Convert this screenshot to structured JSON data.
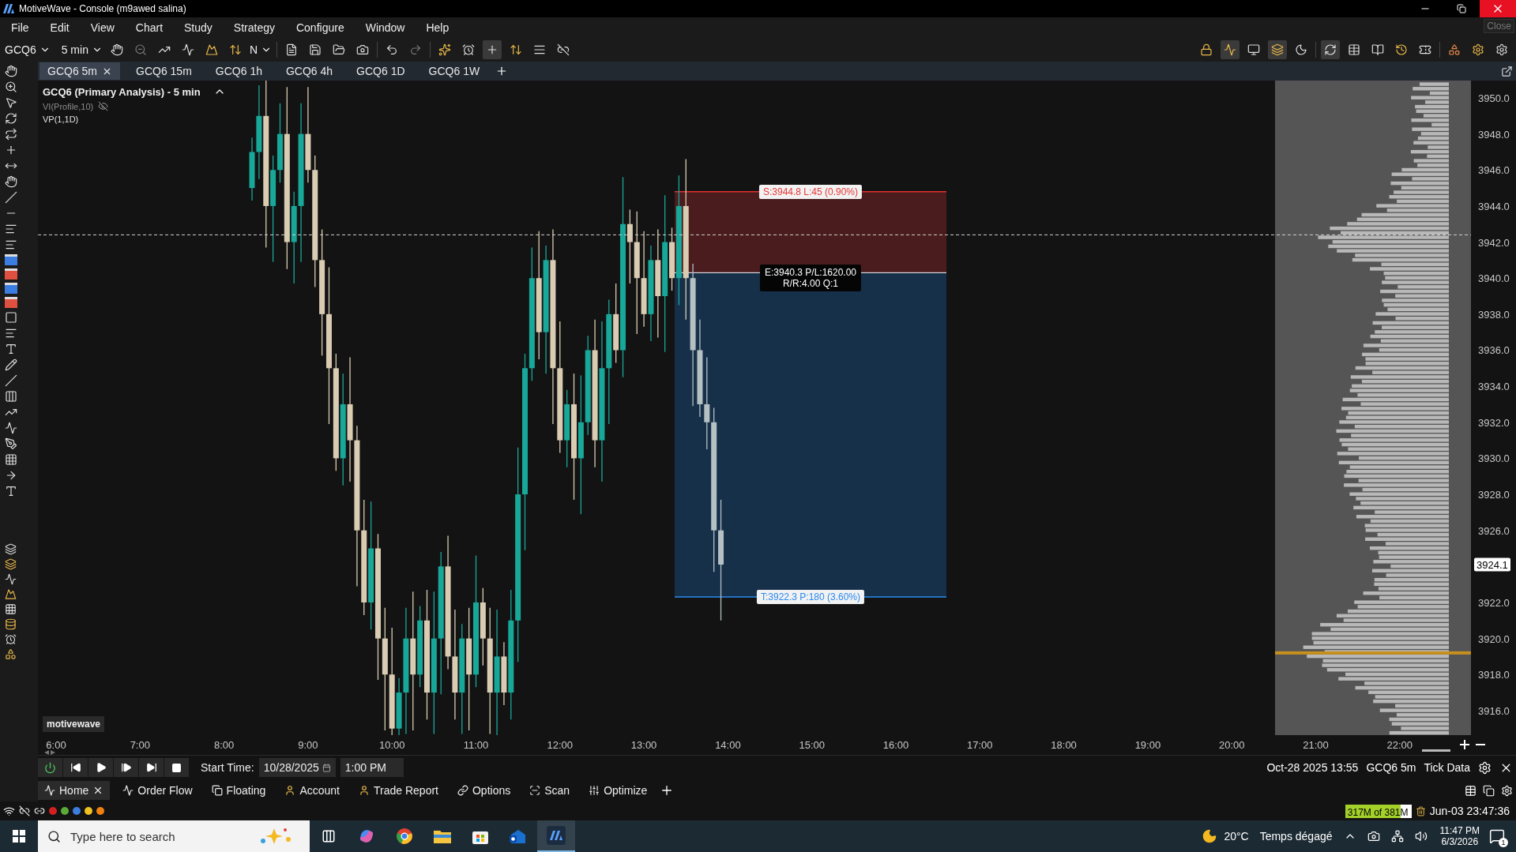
{
  "window": {
    "title": "MotiveWave - Console (m9awed salina)",
    "tooltip": "Close"
  },
  "menu": [
    "File",
    "Edit",
    "View",
    "Chart",
    "Study",
    "Strategy",
    "Configure",
    "Window",
    "Help"
  ],
  "toolbar": {
    "symbol": "GCQ6",
    "interval": "5 min",
    "bar_type": "N"
  },
  "tabs": [
    {
      "label": "GCQ6 5m",
      "selected": true
    },
    {
      "label": "GCQ6 15m",
      "selected": false
    },
    {
      "label": "GCQ6 1h",
      "selected": false
    },
    {
      "label": "GCQ6 4h",
      "selected": false
    },
    {
      "label": "GCQ6 1D",
      "selected": false
    },
    {
      "label": "GCQ6 1W",
      "selected": false
    }
  ],
  "chart": {
    "title": "GCQ6 (Primary Analysis) - 5 min",
    "studies": [
      {
        "label": "VI(Profile,10)",
        "hidden": true
      },
      {
        "label": "VP(1,1D)",
        "hidden": false
      }
    ],
    "brand_label": "motivewave",
    "price_axis": [
      "3950.0",
      "3948.0",
      "3946.0",
      "3944.0",
      "3942.0",
      "3940.0",
      "3938.0",
      "3936.0",
      "3934.0",
      "3932.0",
      "3930.0",
      "3928.0",
      "3926.0",
      "3922.0",
      "3920.0",
      "3918.0",
      "3916.0"
    ],
    "current_price": "3924.1",
    "time_axis": [
      "6:00",
      "7:00",
      "8:00",
      "9:00",
      "10:00",
      "11:00",
      "12:00",
      "13:00",
      "14:00",
      "15:00",
      "16:00",
      "17:00",
      "18:00",
      "19:00",
      "20:00",
      "21:00",
      "22:00"
    ],
    "position": {
      "stop": "S:3944.8 L:45 (0.90%)",
      "entry": [
        "E:3940.3 P/L:1620.00",
        "R/R:4.00 Q:1"
      ],
      "target": "T:3922.3 P:180 (3.60%)"
    }
  },
  "playback": {
    "start_label": "Start Time:",
    "date": "10/28/2025",
    "time": "1:00 PM",
    "status": [
      "Oct-28 2025 13:55",
      "GCQ6 5m",
      "Tick Data"
    ]
  },
  "bottom_tabs": [
    {
      "label": "Home",
      "selected": true
    },
    {
      "label": "Order Flow",
      "selected": false
    },
    {
      "label": "Floating",
      "selected": false
    },
    {
      "label": "Account",
      "selected": false
    },
    {
      "label": "Trade Report",
      "selected": false
    },
    {
      "label": "Options",
      "selected": false
    },
    {
      "label": "Scan",
      "selected": false
    },
    {
      "label": "Optimize",
      "selected": false
    }
  ],
  "status": {
    "dots": [
      {
        "color": "#d42020"
      },
      {
        "color": "#5aaa3a"
      },
      {
        "color": "#3c7ee0"
      },
      {
        "color": "#f0c020"
      },
      {
        "color": "#f08010"
      }
    ],
    "memory": {
      "text": "317M of 381M",
      "level": 0.83
    },
    "clock": "Jun-03 23:47:36"
  },
  "taskbar": {
    "search_placeholder": "Type here to search",
    "temperature": "20°C",
    "weather": "Temps dégagé",
    "time": "11:47 PM",
    "date": "6/3/2026",
    "notifications": "1"
  }
}
